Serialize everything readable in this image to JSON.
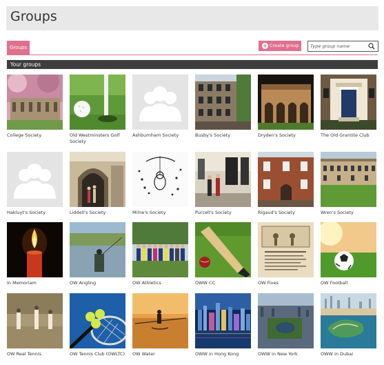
{
  "header": {
    "title": "Groups"
  },
  "tabs": {
    "groups_label": "Groups"
  },
  "toolbar": {
    "create_label": "Create group"
  },
  "search": {
    "placeholder": "Type group name"
  },
  "section": {
    "title": "Your groups"
  },
  "colors": {
    "accent": "#e0708e",
    "section_bar": "#3d3d3d",
    "header_bg": "#e8e8e8"
  },
  "groups": [
    {
      "label": "College Society",
      "icon": "college-building-photo"
    },
    {
      "label": "Old Westminsters Golf Society",
      "icon": "golf-ball-photo"
    },
    {
      "label": "Ashburnham Society",
      "icon": "people-placeholder-icon"
    },
    {
      "label": "Busby's Society",
      "icon": "brick-building-photo"
    },
    {
      "label": "Dryden's Society",
      "icon": "arcade-building-photo"
    },
    {
      "label": "The Old Grantite Club",
      "icon": "doorway-photo"
    },
    {
      "label": "Hakluyt's Society",
      "icon": "people-placeholder-icon"
    },
    {
      "label": "Liddell's Society",
      "icon": "stone-arch-photo"
    },
    {
      "label": "Milne's Society",
      "icon": "bear-illustration"
    },
    {
      "label": "Purcell's Society",
      "icon": "street-people-photo"
    },
    {
      "label": "Rigaud's Society",
      "icon": "red-brick-house-photo"
    },
    {
      "label": "Wren's Society",
      "icon": "lawn-building-photo"
    },
    {
      "label": "In Memoriam",
      "icon": "candle-photo"
    },
    {
      "label": "OW Angling",
      "icon": "angling-photo"
    },
    {
      "label": "OW Athletics",
      "icon": "team-photo"
    },
    {
      "label": "OWW CC",
      "icon": "cricket-bat-photo"
    },
    {
      "label": "OW Fives",
      "icon": "old-print-photo"
    },
    {
      "label": "OW Football",
      "icon": "football-photo"
    },
    {
      "label": "OW Real Tennis",
      "icon": "real-tennis-photo"
    },
    {
      "label": "OW Tennis Club (OWLTC)",
      "icon": "tennis-balls-photo"
    },
    {
      "label": "OW Water",
      "icon": "rowing-photo"
    },
    {
      "label": "OWW in Hong Kong",
      "icon": "hong-kong-skyline-photo"
    },
    {
      "label": "OWW in New York",
      "icon": "new-york-aerial-photo"
    },
    {
      "label": "OWW in Dubai",
      "icon": "dubai-aerial-photo"
    }
  ]
}
